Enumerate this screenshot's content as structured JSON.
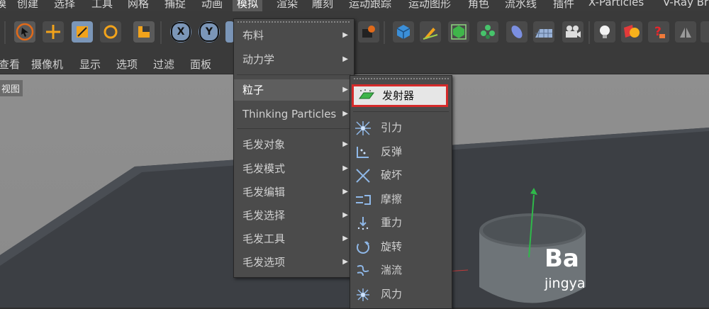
{
  "menubar": {
    "items": [
      "模",
      "创建",
      "选择",
      "工具",
      "网格",
      "捕捉",
      "动画",
      "模拟",
      "渲染",
      "雕刻",
      "运动跟踪",
      "运动图形",
      "角色",
      "流水线",
      "插件",
      "X-Particles",
      "V-Ray Br"
    ],
    "active": "模拟"
  },
  "secbar": {
    "items": [
      "查看",
      "摄像机",
      "显示",
      "选项",
      "过滤",
      "面板"
    ]
  },
  "viewport": {
    "tag": "视图"
  },
  "simulate_menu": {
    "items": [
      {
        "label": "布料",
        "submenu": true
      },
      {
        "label": "动力学",
        "submenu": true
      },
      {
        "label": "粒子",
        "submenu": true
      },
      {
        "label": "Thinking Particles",
        "submenu": true
      },
      {
        "label": "毛发对象",
        "submenu": true
      },
      {
        "label": "毛发模式",
        "submenu": true
      },
      {
        "label": "毛发编辑",
        "submenu": true
      },
      {
        "label": "毛发选择",
        "submenu": true
      },
      {
        "label": "毛发工具",
        "submenu": true
      },
      {
        "label": "毛发选项",
        "submenu": true
      }
    ],
    "highlighted": "粒子"
  },
  "particles_menu": {
    "emitter": "发射器",
    "items": [
      "引力",
      "反弹",
      "破坏",
      "摩擦",
      "重力",
      "旋转",
      "湍流",
      "风力"
    ]
  },
  "toolbar": {
    "axis_x": "X",
    "axis_y": "Y",
    "icons": [
      "move-icon",
      "scale-icon",
      "rotate-icon",
      "live-select-icon",
      "cube-icon",
      "pen-icon",
      "subdivision-icon",
      "cloner-icon",
      "deformer-icon",
      "floor-icon",
      "camera-icon",
      "light-icon",
      "tag-icon",
      "help-icon"
    ]
  },
  "watermark": {
    "line1": "Ba",
    "line2": "jingya"
  }
}
